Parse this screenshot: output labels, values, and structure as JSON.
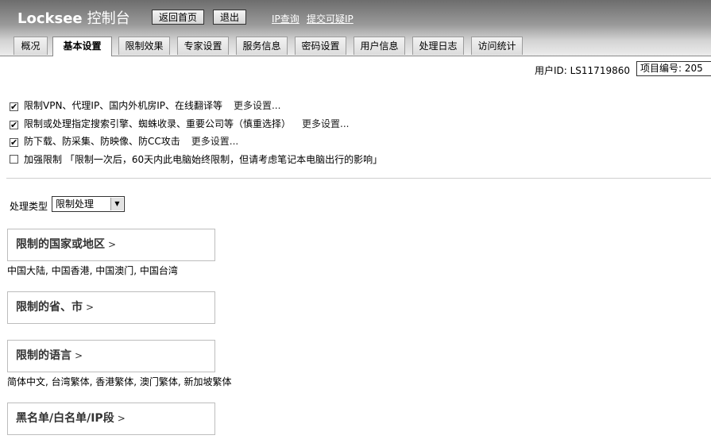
{
  "header": {
    "brand": "Locksee",
    "brand_cn": "控制台",
    "btn_home": "返回首页",
    "btn_logout": "退出",
    "link_ip_query": "IP查询",
    "link_submit_ip": "提交可疑IP"
  },
  "tabs": [
    {
      "label": "概况"
    },
    {
      "label": "基本设置",
      "active": true
    },
    {
      "label": "限制效果"
    },
    {
      "label": "专家设置"
    },
    {
      "label": "服务信息"
    },
    {
      "label": "密码设置"
    },
    {
      "label": "用户信息"
    },
    {
      "label": "处理日志"
    },
    {
      "label": "访问统计"
    }
  ],
  "userbar": {
    "user_id_label": "用户ID:  LS11719860",
    "project_label": "项目编号: 205"
  },
  "options": [
    {
      "checked": true,
      "text": "限制VPN、代理IP、国内外机房IP、在线翻译等",
      "more": "更多设置..."
    },
    {
      "checked": true,
      "text": "限制或处理指定搜索引擎、蜘蛛收录、重要公司等（慎重选择）",
      "more": "更多设置..."
    },
    {
      "checked": true,
      "text": "防下载、防采集、防映像、防CC攻击",
      "more": "更多设置..."
    },
    {
      "checked": false,
      "text": "加强限制 「限制一次后，60天内此电脑始终限制，但请考虑笔记本电脑出行的影响」",
      "more": ""
    }
  ],
  "process_type": {
    "label": "处理类型",
    "selected": "限制处理"
  },
  "sections": {
    "country": {
      "title": "限制的国家或地区",
      "chevron": ">",
      "summary": "中国大陆, 中国香港, 中国澳门, 中国台湾"
    },
    "province": {
      "title": "限制的省、市",
      "chevron": ">",
      "summary": ""
    },
    "language": {
      "title": "限制的语言",
      "chevron": ">",
      "summary": "简体中文, 台湾繁体, 香港繁体, 澳门繁体, 新加坡繁体"
    },
    "lists": {
      "title": "黑名单/白名单/IP段",
      "chevron": ">",
      "summary": ""
    }
  },
  "check_glyph": "✔"
}
